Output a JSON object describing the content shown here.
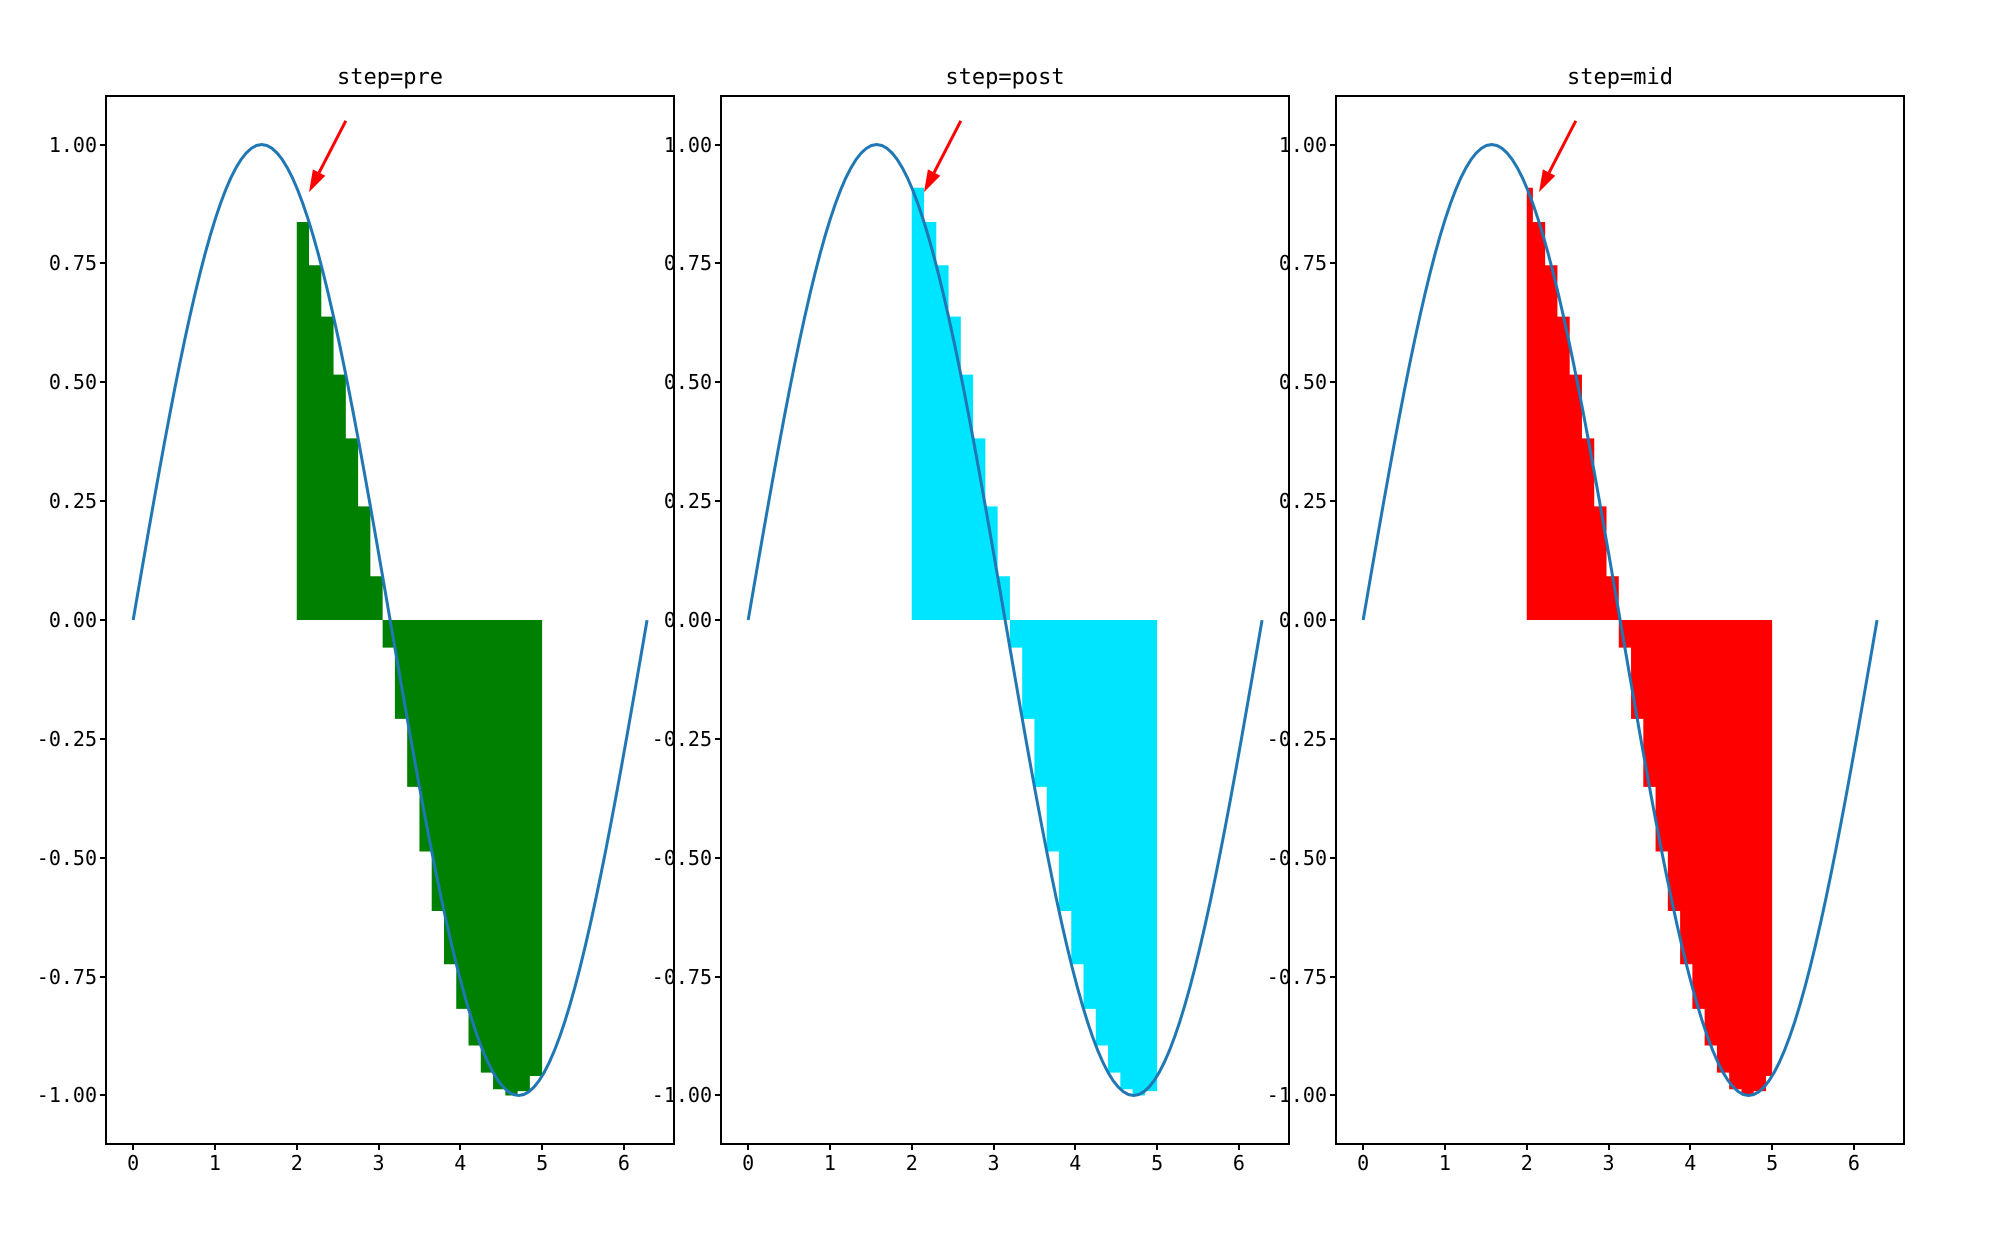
{
  "chart_data": [
    {
      "type": "line",
      "title": "step=pre",
      "xlabel": "",
      "ylabel": "",
      "xlim": [
        -0.32,
        6.6
      ],
      "ylim": [
        -1.1,
        1.1
      ],
      "xticks": [
        0,
        1,
        2,
        3,
        4,
        5,
        6
      ],
      "yticks": [
        -1.0,
        -0.75,
        -0.5,
        -0.25,
        0.0,
        0.25,
        0.5,
        0.75,
        1.0
      ],
      "line": {
        "description": "y = sin(x) for x in [0, 2π]",
        "x_range": [
          0,
          6.283
        ],
        "samples": 100,
        "color": "#1f77b4"
      },
      "fill": {
        "step": "pre",
        "color": "green",
        "x": [
          2.0,
          2.15,
          2.3,
          2.45,
          2.6,
          2.75,
          2.9,
          3.05,
          3.2,
          3.35,
          3.5,
          3.65,
          3.8,
          3.95,
          4.1,
          4.25,
          4.4,
          4.55,
          4.7,
          4.85,
          5.0
        ],
        "y": [
          0.909,
          0.837,
          0.746,
          0.638,
          0.516,
          0.382,
          0.239,
          0.092,
          -0.058,
          -0.208,
          -0.351,
          -0.487,
          -0.612,
          -0.724,
          -0.818,
          -0.895,
          -0.952,
          -0.987,
          -1.0,
          -0.991,
          -0.959
        ]
      },
      "annotation": {
        "type": "arrow",
        "color": "red",
        "xy_head": [
          2.15,
          0.9
        ],
        "xy_tail": [
          2.6,
          1.05
        ]
      }
    },
    {
      "type": "line",
      "title": "step=post",
      "xlabel": "",
      "ylabel": "",
      "xlim": [
        -0.32,
        6.6
      ],
      "ylim": [
        -1.1,
        1.1
      ],
      "xticks": [
        0,
        1,
        2,
        3,
        4,
        5,
        6
      ],
      "yticks": [
        -1.0,
        -0.75,
        -0.5,
        -0.25,
        0.0,
        0.25,
        0.5,
        0.75,
        1.0
      ],
      "line": {
        "description": "y = sin(x) for x in [0, 2π]",
        "x_range": [
          0,
          6.283
        ],
        "samples": 100,
        "color": "#1f77b4"
      },
      "fill": {
        "step": "post",
        "color": "cyan",
        "x": [
          2.0,
          2.15,
          2.3,
          2.45,
          2.6,
          2.75,
          2.9,
          3.05,
          3.2,
          3.35,
          3.5,
          3.65,
          3.8,
          3.95,
          4.1,
          4.25,
          4.4,
          4.55,
          4.7,
          4.85,
          5.0
        ],
        "y": [
          0.909,
          0.837,
          0.746,
          0.638,
          0.516,
          0.382,
          0.239,
          0.092,
          -0.058,
          -0.208,
          -0.351,
          -0.487,
          -0.612,
          -0.724,
          -0.818,
          -0.895,
          -0.952,
          -0.987,
          -1.0,
          -0.991,
          -0.959
        ]
      },
      "annotation": {
        "type": "arrow",
        "color": "red",
        "xy_head": [
          2.15,
          0.9
        ],
        "xy_tail": [
          2.6,
          1.05
        ]
      }
    },
    {
      "type": "line",
      "title": "step=mid",
      "xlabel": "",
      "ylabel": "",
      "xlim": [
        -0.32,
        6.6
      ],
      "ylim": [
        -1.1,
        1.1
      ],
      "xticks": [
        0,
        1,
        2,
        3,
        4,
        5,
        6
      ],
      "yticks": [
        -1.0,
        -0.75,
        -0.5,
        -0.25,
        0.0,
        0.25,
        0.5,
        0.75,
        1.0
      ],
      "line": {
        "description": "y = sin(x) for x in [0, 2π]",
        "x_range": [
          0,
          6.283
        ],
        "samples": 100,
        "color": "#1f77b4"
      },
      "fill": {
        "step": "mid",
        "color": "red",
        "x": [
          2.0,
          2.15,
          2.3,
          2.45,
          2.6,
          2.75,
          2.9,
          3.05,
          3.2,
          3.35,
          3.5,
          3.65,
          3.8,
          3.95,
          4.1,
          4.25,
          4.4,
          4.55,
          4.7,
          4.85,
          5.0
        ],
        "y": [
          0.909,
          0.837,
          0.746,
          0.638,
          0.516,
          0.382,
          0.239,
          0.092,
          -0.058,
          -0.208,
          -0.351,
          -0.487,
          -0.612,
          -0.724,
          -0.818,
          -0.895,
          -0.952,
          -0.987,
          -1.0,
          -0.991,
          -0.959
        ]
      },
      "annotation": {
        "type": "arrow",
        "color": "red",
        "xy_head": [
          2.15,
          0.9
        ],
        "xy_tail": [
          2.6,
          1.05
        ]
      }
    }
  ],
  "colors": {
    "line": "#1f77b4",
    "arrow": "red",
    "fills": [
      "green",
      "#00e5ff",
      "red"
    ]
  }
}
